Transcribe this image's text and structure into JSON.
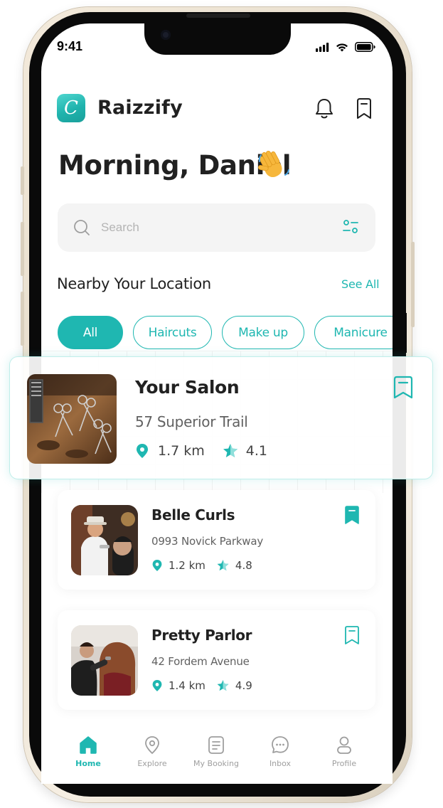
{
  "status_bar": {
    "time": "9:41"
  },
  "header": {
    "app_name": "Raizzify",
    "logo_letter": "C"
  },
  "greeting": {
    "text": "Morning, Daniel"
  },
  "search": {
    "placeholder": "Search"
  },
  "nearby": {
    "title": "Nearby Your Location",
    "see_all": "See All"
  },
  "categories": [
    "All",
    "Haircuts",
    "Make up",
    "Manicure"
  ],
  "featured_salon": {
    "name": "Your Salon",
    "address": "57 Superior Trail",
    "distance": "1.7 km",
    "rating": "4.1"
  },
  "salons": [
    {
      "name": "Belle Curls",
      "address": "0993 Novick Parkway",
      "distance": "1.2 km",
      "rating": "4.8",
      "bookmarked": true
    },
    {
      "name": "Pretty Parlor",
      "address": "42 Fordem Avenue",
      "distance": "1.4 km",
      "rating": "4.9",
      "bookmarked": false
    }
  ],
  "bottom_nav": [
    "Home",
    "Explore",
    "My Booking",
    "Inbox",
    "Profile"
  ],
  "colors": {
    "accent": "#1fb7b1",
    "text": "#212121",
    "muted": "#9e9e9e"
  }
}
